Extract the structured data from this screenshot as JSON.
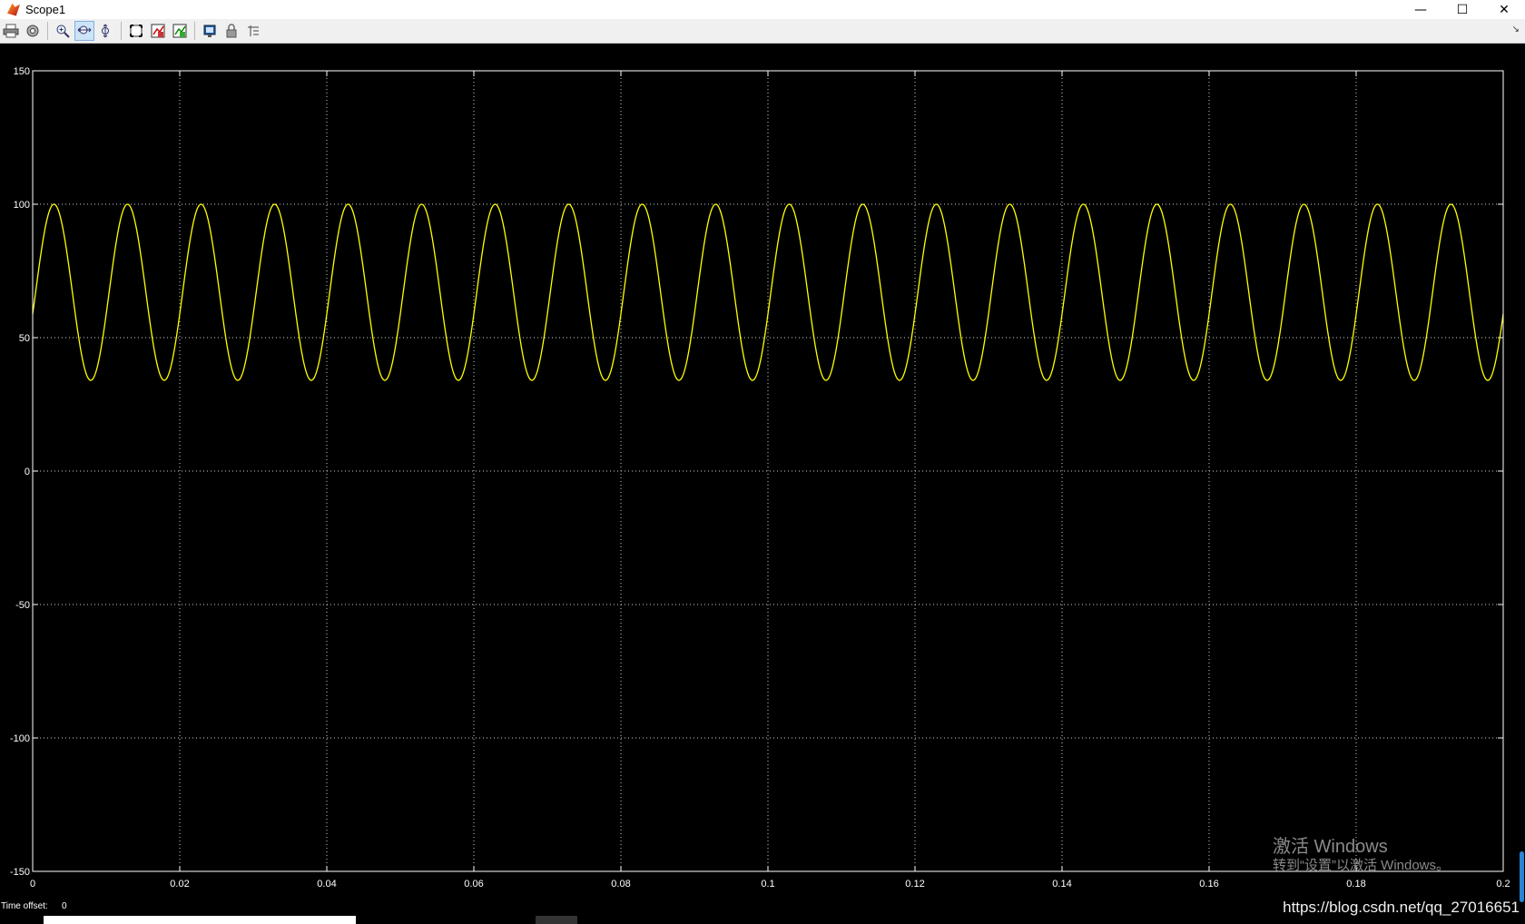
{
  "window": {
    "title": "Scope1",
    "controls": {
      "minimize": "—",
      "maximize": "☐",
      "close": "✕"
    }
  },
  "toolbar": {
    "buttons": [
      {
        "name": "print-icon",
        "label": "Print"
      },
      {
        "name": "parameters-icon",
        "label": "Parameters"
      },
      {
        "name": "zoom-icon",
        "label": "Zoom"
      },
      {
        "name": "zoom-x-icon",
        "label": "Zoom X-axis",
        "active": true
      },
      {
        "name": "zoom-y-icon",
        "label": "Zoom Y-axis"
      },
      {
        "name": "autoscale-icon",
        "label": "Autoscale"
      },
      {
        "name": "save-axes-icon",
        "label": "Save current axes settings"
      },
      {
        "name": "restore-axes-icon",
        "label": "Restore saved axes settings"
      },
      {
        "name": "floating-scope-icon",
        "label": "Floating scope"
      },
      {
        "name": "lock-icon",
        "label": "Lock axes selection"
      },
      {
        "name": "signal-selector-icon",
        "label": "Signal selection"
      }
    ]
  },
  "chart_data": {
    "type": "line",
    "title": "",
    "xlabel": "",
    "ylabel": "",
    "xlim": [
      0,
      0.2
    ],
    "ylim": [
      -150,
      150
    ],
    "xticks": [
      "0",
      "0.02",
      "0.04",
      "0.06",
      "0.08",
      "0.1",
      "0.12",
      "0.14",
      "0.16",
      "0.18",
      "0.2"
    ],
    "xtick_values": [
      0,
      0.02,
      0.04,
      0.06,
      0.08,
      0.1,
      0.12,
      0.14,
      0.16,
      0.18,
      0.2
    ],
    "yticks": [
      "150",
      "100",
      "50",
      "0",
      "-50",
      "-100",
      "-150"
    ],
    "ytick_values": [
      150,
      100,
      50,
      0,
      -50,
      -100,
      -150
    ],
    "grid": true,
    "background": "#000000",
    "axis_color": "#ffffff",
    "series": [
      {
        "color": "#ffff00",
        "function": "offset + amplitude*sin(2*pi*frequency*t + phase)",
        "offset": 67,
        "amplitude": 33,
        "frequency": 100,
        "phase": -0.25
      }
    ]
  },
  "status": {
    "time_offset_label": "Time offset:",
    "time_offset_value": "0"
  },
  "overlay": {
    "activate_line1": "激活 Windows",
    "activate_line2": "转到“设置”以激活 Windows。",
    "url": "https://blog.csdn.net/qq_27016651"
  }
}
